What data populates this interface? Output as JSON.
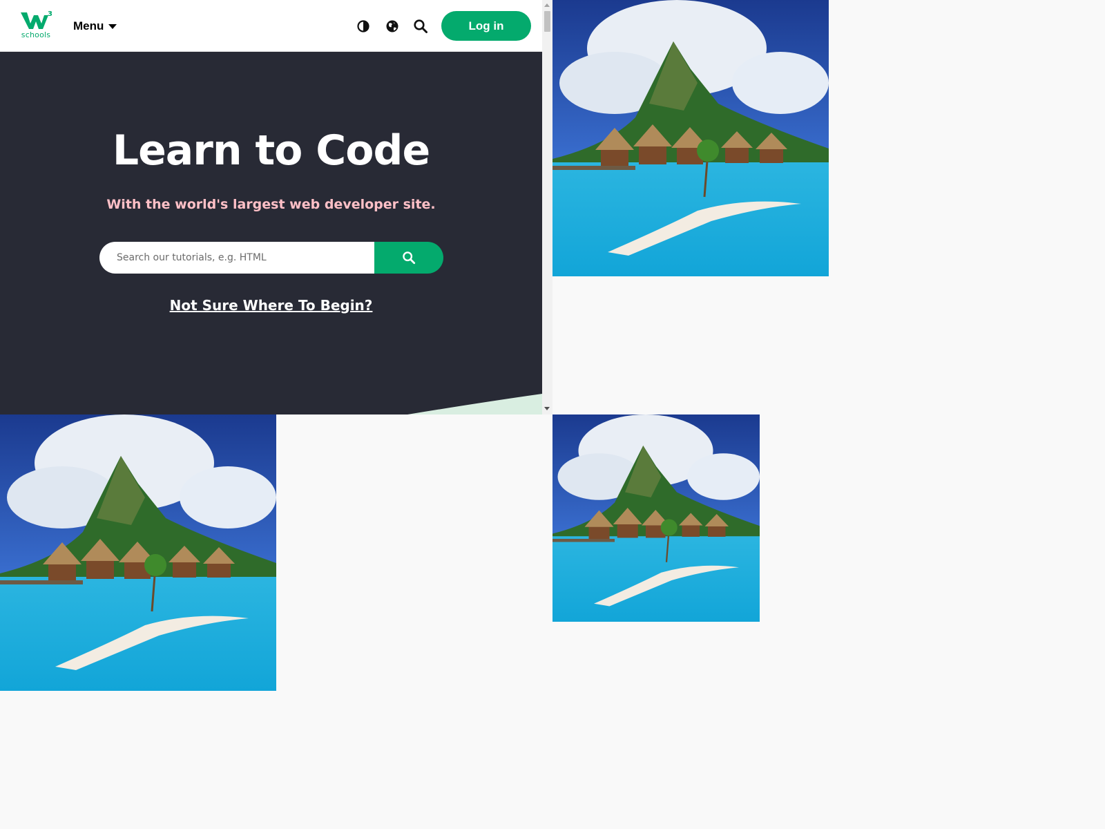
{
  "frame": {
    "nav": {
      "logo_top": "3",
      "logo_text": "schools",
      "menu_label": "Menu",
      "icons": [
        "contrast-icon",
        "globe-icon",
        "search-icon"
      ],
      "login_label": "Log in"
    },
    "hero": {
      "title": "Learn to Code",
      "subtitle": "With the world's largest web developer site.",
      "search_placeholder": "Search our tutorials, e.g. HTML",
      "begin_link": "Not Sure Where To Begin?"
    }
  },
  "photos": [
    {
      "name": "island-photo-top-right",
      "subject": "tropical island with overwater bungalows"
    },
    {
      "name": "island-photo-bottom-left",
      "subject": "tropical island with overwater bungalows"
    },
    {
      "name": "island-photo-bottom-right",
      "subject": "tropical island with overwater bungalows"
    }
  ],
  "colors": {
    "brand_green": "#04aa6d",
    "hero_bg": "#282a35",
    "subtitle_pink": "#ffc0c7",
    "page_bg": "#f9f9f9"
  }
}
